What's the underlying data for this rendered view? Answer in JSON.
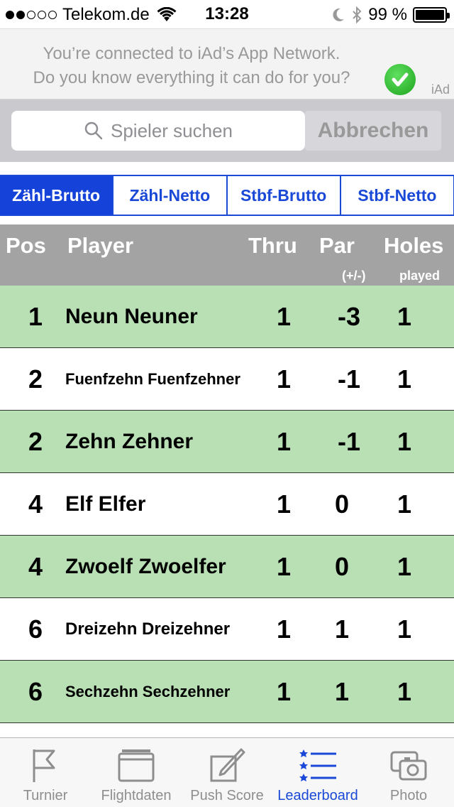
{
  "status": {
    "carrier": "Telekom.de",
    "time": "13:28",
    "battery": "99 %"
  },
  "ad": {
    "line1": "You’re connected to iAd’s App Network.",
    "line2": "Do you know everything it can do for you?",
    "logo": "iAd"
  },
  "search": {
    "placeholder": "Spieler suchen",
    "cancel": "Abbrechen"
  },
  "tabs": [
    {
      "label": "Zähl-Brutto",
      "active": true
    },
    {
      "label": "Zähl-Netto",
      "active": false
    },
    {
      "label": "Stbf-Brutto",
      "active": false
    },
    {
      "label": "Stbf-Netto",
      "active": false
    }
  ],
  "table": {
    "headers": {
      "pos": "Pos",
      "player": "Player",
      "thru": "Thru",
      "par": "Par",
      "par_sub": "(+/-)",
      "holes": "Holes",
      "holes_sub": "played"
    },
    "rows": [
      {
        "pos": "1",
        "player": "Neun Neuner",
        "thru": "1",
        "par": "-3",
        "holes": "1"
      },
      {
        "pos": "2",
        "player": "Fuenfzehn Fuenfzehner",
        "thru": "1",
        "par": "-1",
        "holes": "1"
      },
      {
        "pos": "2",
        "player": "Zehn Zehner",
        "thru": "1",
        "par": "-1",
        "holes": "1"
      },
      {
        "pos": "4",
        "player": "Elf Elfer",
        "thru": "1",
        "par": "0",
        "holes": "1"
      },
      {
        "pos": "4",
        "player": "Zwoelf Zwoelfer",
        "thru": "1",
        "par": "0",
        "holes": "1"
      },
      {
        "pos": "6",
        "player": "Dreizehn Dreizehner",
        "thru": "1",
        "par": "1",
        "holes": "1"
      },
      {
        "pos": "6",
        "player": "Sechzehn Sechzehner",
        "thru": "1",
        "par": "1",
        "holes": "1"
      }
    ]
  },
  "tabbar": [
    {
      "label": "Turnier",
      "icon": "flag-icon"
    },
    {
      "label": "Flightdaten",
      "icon": "window-icon"
    },
    {
      "label": "Push Score",
      "icon": "edit-icon"
    },
    {
      "label": "Leaderboard",
      "icon": "list-icon",
      "active": true
    },
    {
      "label": "Photo",
      "icon": "camera-icon"
    }
  ],
  "colors": {
    "accent": "#1a49d8",
    "row_highlight": "#b9e0b5",
    "header_bg": "#a3a3a3"
  }
}
